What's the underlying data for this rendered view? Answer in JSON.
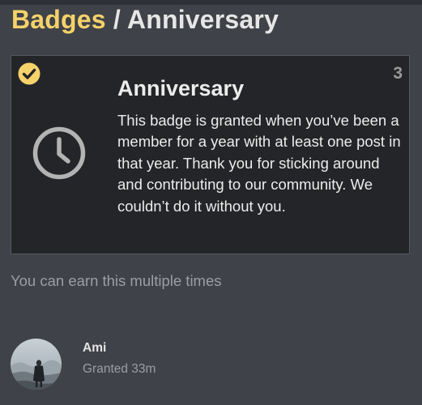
{
  "breadcrumb": {
    "parent_label": "Badges",
    "separator": " / ",
    "current_label": "Anniversary"
  },
  "badge": {
    "name": "Anniversary",
    "count": "3",
    "description": "This badge is granted when you’ve been a member for a year with at least one post in that year. Thank you for sticking around and contributing to our community. We couldn’t do it without you.",
    "icon": "clock-icon",
    "earned_icon": "check-circle-icon"
  },
  "multiple_note": "You can earn this multiple times",
  "grantees": [
    {
      "username": "Ami",
      "granted_text": "Granted 33m"
    }
  ],
  "colors": {
    "background": "#3f4248",
    "card": "#242528",
    "accent": "#f5d26a",
    "text": "#ececec",
    "muted": "#9b9ea3"
  }
}
